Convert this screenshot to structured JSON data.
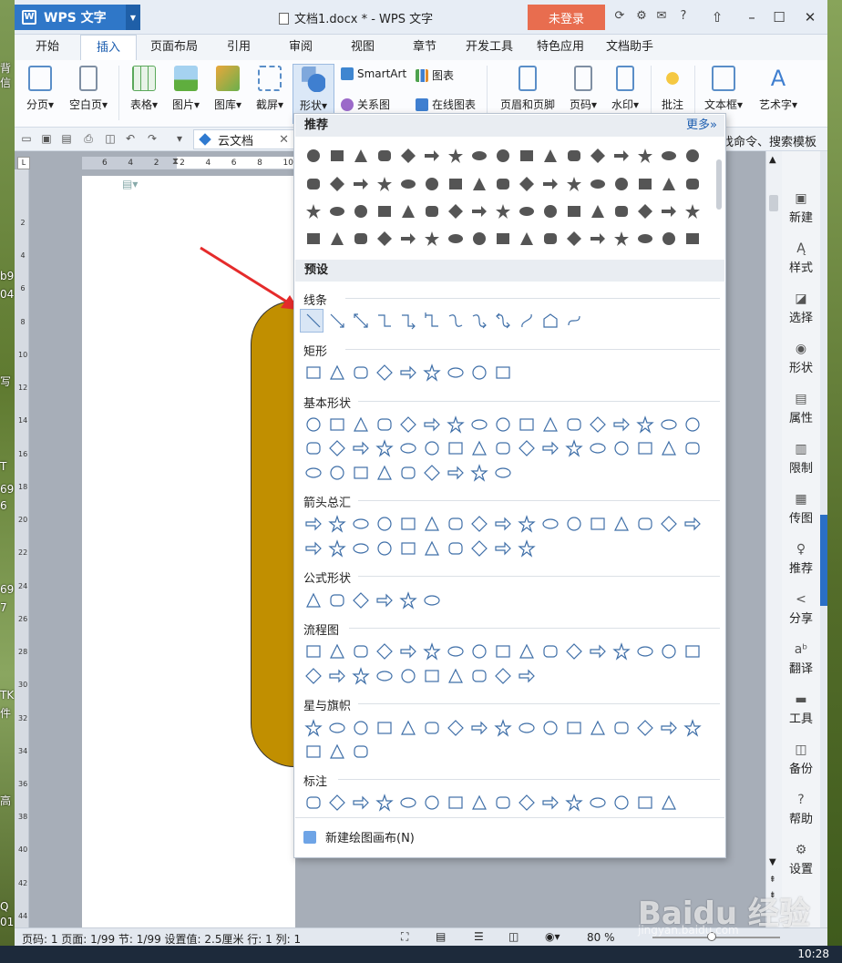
{
  "app": {
    "name": "WPS 文字",
    "window_title": "文档1.docx * - WPS 文字",
    "login_label": "未登录"
  },
  "tabs": [
    "开始",
    "插入",
    "页面布局",
    "引用",
    "审阅",
    "视图",
    "章节",
    "开发工具",
    "特色应用",
    "文档助手"
  ],
  "active_tab": "插入",
  "ribbon": {
    "page_break": "分页",
    "blank_page": "空白页",
    "table": "表格",
    "picture": "图片",
    "gallery": "图库",
    "screenshot": "截屏",
    "shapes": "形状",
    "smartart": "SmartArt",
    "chart": "图表",
    "relation": "关系图",
    "online_chart": "在线图表",
    "header_footer": "页眉和页脚",
    "page_number": "页码",
    "watermark": "水印",
    "comment": "批注",
    "textbox": "文本框",
    "wordart": "艺术字"
  },
  "quickbar": {
    "cloud_tab": "云文档",
    "search_hint": "找命令、搜索模板"
  },
  "ruler_numbers": [
    "6",
    "4",
    "2",
    "2",
    "4",
    "6",
    "8",
    "10"
  ],
  "vruler_numbers": [
    "2",
    "4",
    "6",
    "8",
    "10",
    "12",
    "14",
    "16",
    "18",
    "20",
    "22",
    "24",
    "26",
    "28",
    "30",
    "32",
    "34",
    "36",
    "38",
    "40",
    "42",
    "44"
  ],
  "popup": {
    "recommend_label": "推荐",
    "more_label": "更多»",
    "preset_label": "预设",
    "categories": [
      "线条",
      "矩形",
      "基本形状",
      "箭头总汇",
      "公式形状",
      "流程图",
      "星与旗帜",
      "标注"
    ],
    "new_canvas": "新建绘图画布(N)"
  },
  "right_panel": [
    "新建",
    "样式",
    "选择",
    "形状",
    "属性",
    "限制",
    "传图",
    "推荐",
    "分享",
    "翻译",
    "工具",
    "备份",
    "帮助",
    "设置"
  ],
  "status": {
    "text": "页码: 1   页面: 1/99   节: 1/99   设置值: 2.5厘米   行: 1   列: 1",
    "zoom": "80 %"
  },
  "desktop_fragments": [
    "背",
    "信",
    "b9",
    "04",
    "写",
    "T",
    "69",
    "6",
    "69",
    "7",
    "TK",
    "件",
    "高",
    "Q",
    "01"
  ],
  "watermark": {
    "brand": "Baidu 经验",
    "sub": "jingyan.baidu.com"
  },
  "taskbar": {
    "clock": "10:28"
  },
  "colors": {
    "shape_fill": "#c18f00",
    "accent": "#2f77c8",
    "login": "#e86d4f"
  }
}
